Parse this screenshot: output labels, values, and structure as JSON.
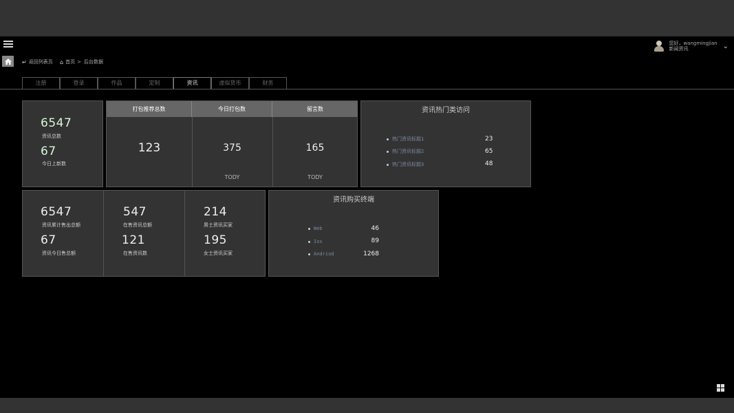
{
  "user": {
    "greeting": "您好，wangmingjian",
    "role": "新闻资讯"
  },
  "breadcrumb": {
    "back": "返回列表页",
    "home": "首页",
    "current": "后台数据",
    "separator": ">"
  },
  "tabs": [
    {
      "label": "注册",
      "active": false
    },
    {
      "label": "登录",
      "active": false
    },
    {
      "label": "作品",
      "active": false
    },
    {
      "label": "定制",
      "active": false
    },
    {
      "label": "资讯",
      "active": true
    },
    {
      "label": "虚拟货币",
      "active": false
    },
    {
      "label": "财务",
      "active": false
    }
  ],
  "summary": {
    "total_value": "6547",
    "total_label": "资讯总数",
    "new_value": "67",
    "new_label": "今日上新数"
  },
  "packs": {
    "headers": [
      "打包推荐总数",
      "今日打包数",
      "留言数"
    ],
    "values": [
      "123",
      "375",
      "165"
    ],
    "footers": [
      "",
      "TODY",
      "TODY"
    ]
  },
  "hot": {
    "title": "资讯热门类访问",
    "items": [
      {
        "name": "热门资讯标题1",
        "value": "23"
      },
      {
        "name": "热门资讯标题2",
        "value": "65"
      },
      {
        "name": "热门资讯标题3",
        "value": "48"
      }
    ]
  },
  "sales": {
    "col1": {
      "v1": "6547",
      "l1": "资讯累计售出总额",
      "v2": "67",
      "l2": "资讯今日售总额"
    },
    "col2": {
      "v1": "547",
      "l1": "在售资讯总额",
      "v2": "121",
      "l2": "在售资讯数"
    },
    "col3": {
      "v1": "214",
      "l1": "男士资讯买家",
      "v2": "195",
      "l2": "女士资讯买家"
    }
  },
  "terminals": {
    "title": "资讯购买终端",
    "items": [
      {
        "name": "Web",
        "value": "46"
      },
      {
        "name": "Ios",
        "value": "89"
      },
      {
        "name": "Andriod",
        "value": "1268"
      }
    ]
  },
  "colors": {
    "background": "#000000",
    "panel": "#333333",
    "header": "#666666",
    "accent_text": "#d7f5d7"
  }
}
